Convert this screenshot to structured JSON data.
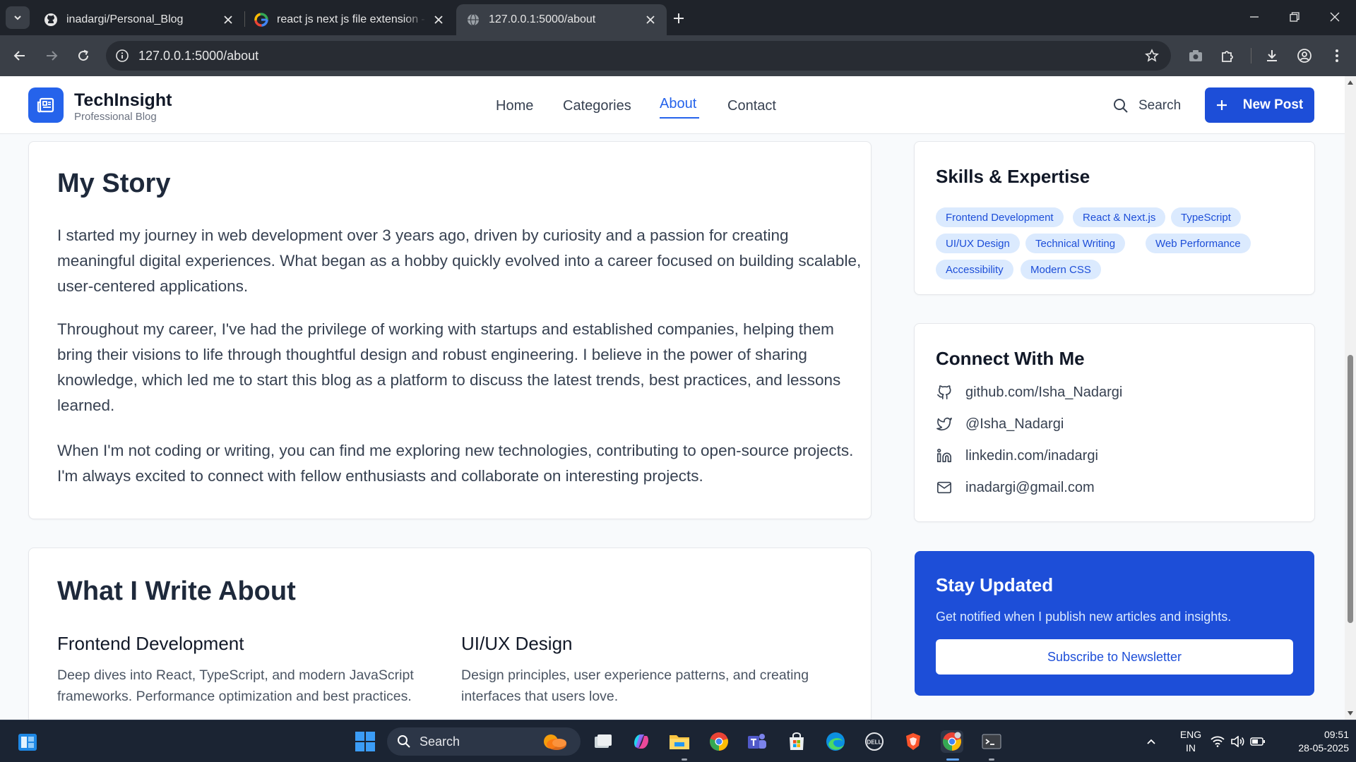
{
  "browser": {
    "tabs": [
      {
        "title": "inadargi/Personal_Blog",
        "icon": "github-icon"
      },
      {
        "title": "react js next js file extension - G",
        "icon": "google-icon"
      },
      {
        "title": "127.0.0.1:5000/about",
        "icon": "globe-icon"
      }
    ],
    "url": "127.0.0.1:5000/about"
  },
  "site": {
    "brand": "TechInsight",
    "tagline": "Professional Blog",
    "nav": [
      "Home",
      "Categories",
      "About",
      "Contact"
    ],
    "active_nav": "About",
    "search_label": "Search",
    "new_post_label": "New Post"
  },
  "story": {
    "title": "My Story",
    "paragraphs": [
      "I started my journey in web development over 3 years ago, driven by curiosity and a passion for creating meaningful digital experiences. What began as a hobby quickly evolved into a career focused on building scalable, user-centered applications.",
      "Throughout my career, I've had the privilege of working with startups and established companies, helping them bring their visions to life through thoughtful design and robust engineering. I believe in the power of sharing knowledge, which led me to start this blog as a platform to discuss the latest trends, best practices, and lessons learned.",
      "When I'm not coding or writing, you can find me exploring new technologies, contributing to open-source projects. I'm always excited to connect with fellow enthusiasts and collaborate on interesting projects."
    ]
  },
  "write_about": {
    "title": "What I Write About",
    "topics": [
      {
        "title": "Frontend Development",
        "desc": "Deep dives into React, TypeScript, and modern JavaScript frameworks. Performance optimization and best practices."
      },
      {
        "title": "UI/UX Design",
        "desc": "Design principles, user experience patterns, and creating interfaces that users love."
      }
    ]
  },
  "skills": {
    "title": "Skills & Expertise",
    "items": [
      "Frontend Development",
      "React & Next.js",
      "TypeScript",
      "UI/UX Design",
      "Technical Writing",
      "Web Performance",
      "Accessibility",
      "Modern CSS"
    ]
  },
  "connect": {
    "title": "Connect With Me",
    "items": [
      {
        "icon": "github-icon",
        "label": "github.com/Isha_Nadargi"
      },
      {
        "icon": "twitter-icon",
        "label": "@Isha_Nadargi"
      },
      {
        "icon": "linkedin-icon",
        "label": "linkedin.com/inadargi"
      },
      {
        "icon": "mail-icon",
        "label": "inadargi@gmail.com"
      }
    ]
  },
  "newsletter": {
    "title": "Stay Updated",
    "subtitle": "Get notified when I publish new articles and insights.",
    "button": "Subscribe to Newsletter"
  },
  "taskbar": {
    "search_label": "Search",
    "lang_top": "ENG",
    "lang_bottom": "IN",
    "time": "09:51",
    "date": "28-05-2025"
  },
  "colors": {
    "accent": "#1d4ed8",
    "chip_bg": "#dbeafe",
    "browser_dark": "#1f232a",
    "taskbar": "#1b2433"
  }
}
